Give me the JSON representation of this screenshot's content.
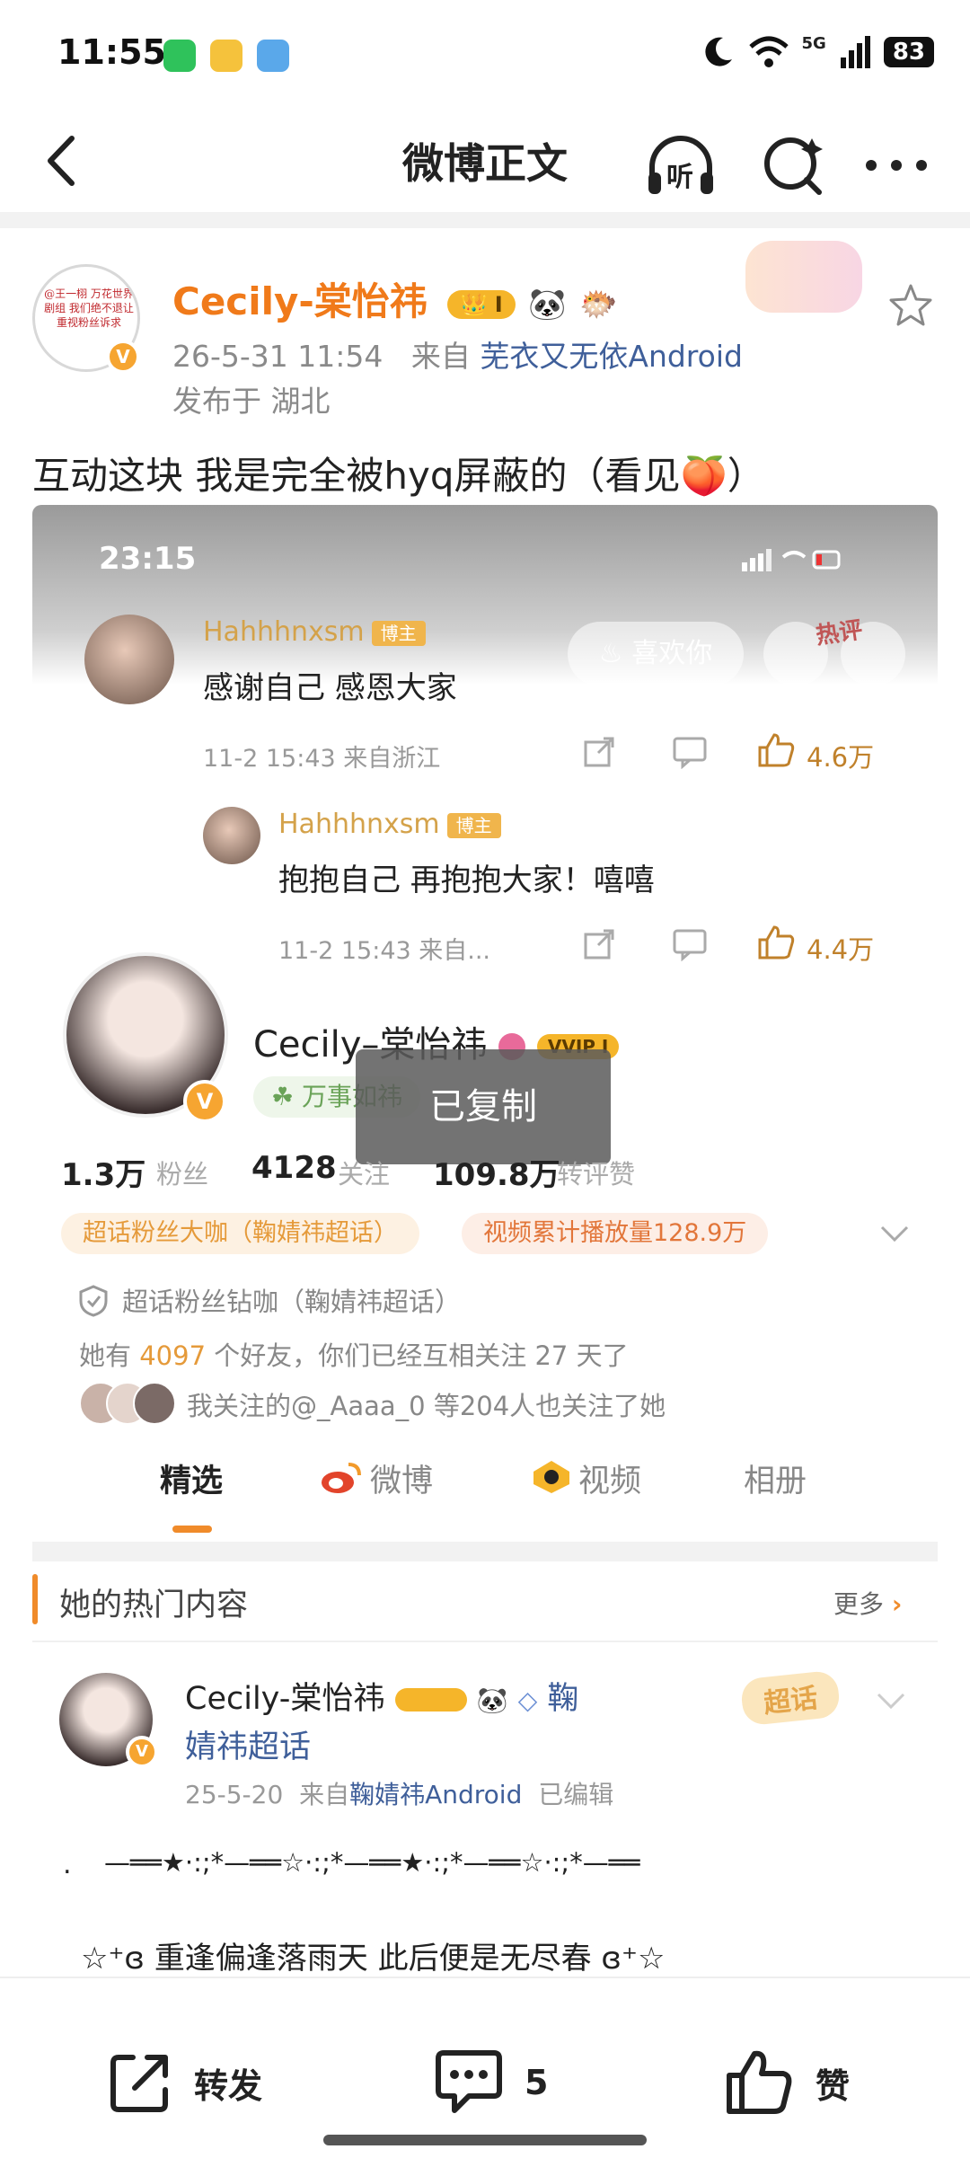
{
  "status_bar": {
    "time": "11:55",
    "signal": "5G",
    "battery": "83",
    "app_icons": [
      "wechat-icon",
      "weibo-icon",
      "gallery-icon"
    ]
  },
  "nav": {
    "title": "微博正文",
    "listen_label": "听"
  },
  "post": {
    "author": "Cecily-棠怡祎",
    "avatar_text": "@王一栩 万花世界剧组 我们绝不退让 重视粉丝诉求",
    "timestamp": "26-5-31 11:54",
    "source_prefix": "来自",
    "source": "芜衣又无依Android",
    "location": "发布于 湖北",
    "text": "互动这块 我是完全被hyq屏蔽的（看见🍑）",
    "member_badge": "I"
  },
  "screenshot": {
    "time": "23:15",
    "like_pill": "喜欢你",
    "hot_label": "热评",
    "toast": "已复制",
    "comments": [
      {
        "name": "Hahhhnxsm",
        "badge": "博主",
        "text": "感谢自己 感恩大家",
        "meta": "11-2 15:43 来自浙江",
        "likes": "4.6万"
      },
      {
        "name": "Hahhhnxsm",
        "badge": "博主",
        "text": "抱抱自己 再抱抱大家！嘻嘻",
        "meta": "11-2 15:43 来自...",
        "likes": "4.4万"
      }
    ],
    "profile": {
      "name": "Cecily–棠怡祎",
      "vip": "VVIP I",
      "motto": "万事如祎",
      "stats": [
        {
          "num": "1.3万",
          "label": "粉丝"
        },
        {
          "num": "4128",
          "label": "关注"
        },
        {
          "num": "109.8万",
          "label": "转评赞"
        }
      ],
      "tags": [
        "超话粉丝大咖（鞠婧祎超话）",
        "视频累计播放量128.9万"
      ],
      "diamond_line": "超话粉丝钻咖（鞠婧祎超话）",
      "friends_pre": "她有",
      "friends_num": "4097",
      "friends_post": "个好友，你们已经互相关注 27 天了",
      "mutual": "我关注的@_Aaaa_0 等204人也关注了她",
      "tabs": [
        "精选",
        "微博",
        "视频",
        "相册"
      ]
    },
    "hot": {
      "title": "她的热门内容",
      "more": "更多",
      "author": "Cecily-棠怡祎",
      "topic_line1": "鞠",
      "topic_line2": "婧祎超话",
      "meta_date": "25-5-20",
      "meta_from": "来自",
      "meta_src": "鞠婧祎Android",
      "meta_edit": "已编辑",
      "chaohua": "超话",
      "deco": "—══★·:;*—══☆·:;*—══★·:;*—══☆·:;*—══",
      "deco_dot": ".",
      "poem": "☆⁺ɞ 重逢偏逢落雨天  此后便是无尽春 ɞ⁺☆"
    }
  },
  "actions": {
    "repost": "转发",
    "comment_count": "5",
    "like": "赞"
  },
  "colors": {
    "orange_name": "#f07a1a",
    "link_blue": "#3f5f9a",
    "gold": "#d4a24a"
  }
}
